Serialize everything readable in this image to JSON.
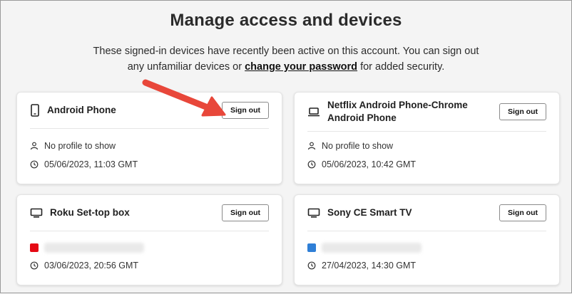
{
  "page": {
    "title": "Manage access and devices",
    "subtitle_line1": "These signed-in devices have recently been active on this account. You can sign out",
    "subtitle_pre": "any unfamiliar devices or ",
    "subtitle_link": "change your password",
    "subtitle_post": " for added security."
  },
  "devices": [
    {
      "name": "Android Phone",
      "device_icon": "phone-icon",
      "profile": "No profile to show",
      "last_active": "05/06/2023, 11:03 GMT",
      "sign_out_label": "Sign out"
    },
    {
      "name": "Netflix Android Phone-Chrome Android Phone",
      "device_icon": "laptop-icon",
      "profile": "No profile to show",
      "last_active": "05/06/2023, 10:42 GMT",
      "sign_out_label": "Sign out"
    },
    {
      "name": "Roku Set-top box",
      "device_icon": "tv-icon",
      "profile_avatar_color": "#e50914",
      "last_active": "03/06/2023, 20:56 GMT",
      "sign_out_label": "Sign out"
    },
    {
      "name": "Sony CE Smart TV",
      "device_icon": "tv-icon",
      "profile_avatar_color": "#2f7fd6",
      "last_active": "27/04/2023, 14:30 GMT",
      "sign_out_label": "Sign out"
    }
  ],
  "annotation": {
    "arrow_color": "#e8473a"
  }
}
